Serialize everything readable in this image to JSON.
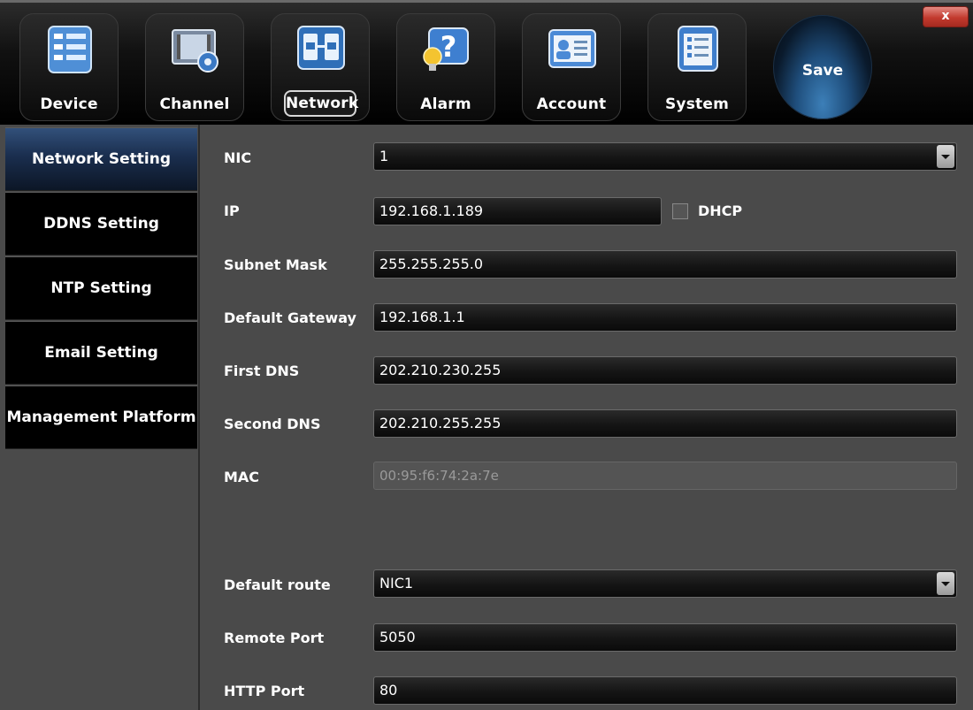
{
  "toolbar": {
    "tabs": [
      {
        "label": "Device",
        "icon": "device-icon"
      },
      {
        "label": "Channel",
        "icon": "channel-icon"
      },
      {
        "label": "Network",
        "icon": "network-icon"
      },
      {
        "label": "Alarm",
        "icon": "alarm-icon"
      },
      {
        "label": "Account",
        "icon": "account-icon"
      },
      {
        "label": "System",
        "icon": "system-icon"
      }
    ],
    "active_tab": "Network",
    "save_label": "Save",
    "close_label": "x"
  },
  "sidebar": {
    "items": [
      {
        "label": "Network Setting"
      },
      {
        "label": "DDNS Setting"
      },
      {
        "label": "NTP Setting"
      },
      {
        "label": "Email Setting"
      },
      {
        "label": "Management Platform"
      }
    ],
    "active_item": "Network Setting"
  },
  "form": {
    "nic": {
      "label": "NIC",
      "value": "1"
    },
    "ip": {
      "label": "IP",
      "value": "192.168.1.189"
    },
    "dhcp": {
      "label": "DHCP",
      "checked": false
    },
    "subnet": {
      "label": "Subnet Mask",
      "value": "255.255.255.0"
    },
    "gateway": {
      "label": "Default Gateway",
      "value": "192.168.1.1"
    },
    "first_dns": {
      "label": "First DNS",
      "value": "202.210.230.255"
    },
    "second_dns": {
      "label": "Second DNS",
      "value": "202.210.255.255"
    },
    "mac": {
      "label": "MAC",
      "value": "00:95:f6:74:2a:7e"
    },
    "default_route": {
      "label": "Default route",
      "value": "NIC1"
    },
    "remote_port": {
      "label": "Remote Port",
      "value": "5050"
    },
    "http_port": {
      "label": "HTTP Port",
      "value": "80"
    }
  },
  "colors": {
    "accent_blue": "#1f4e7c",
    "close_red": "#c23a2e",
    "panel_bg": "#4a4a4a"
  }
}
